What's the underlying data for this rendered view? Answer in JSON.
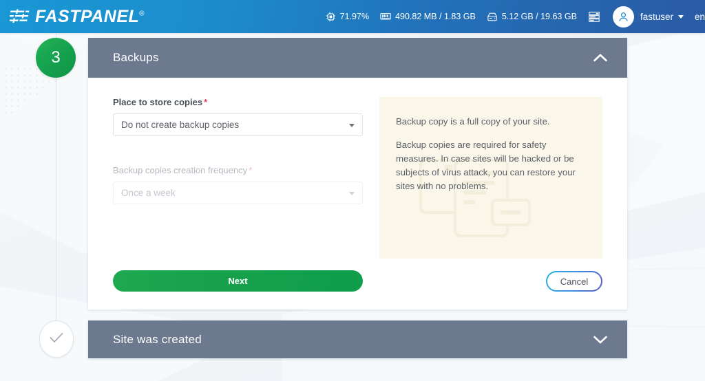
{
  "topbar": {
    "logo_text": "FASTPANEL",
    "logo_reg": "®",
    "logo_icon": "equalizer-icon",
    "stats": [
      {
        "icon": "cpu-icon",
        "value": "71.97%"
      },
      {
        "icon": "memory-icon",
        "value": "490.82 MB / 1.83 GB"
      },
      {
        "icon": "disk-icon",
        "value": "5.12 GB / 19.63 GB"
      }
    ],
    "server_icon": "server-stack-icon",
    "user": {
      "avatar_icon": "user-avatar-icon",
      "name": "fastuser",
      "caret_icon": "chevron-down-icon"
    },
    "language": "en"
  },
  "stepper": {
    "current_step_number": "3",
    "completed_icon": "check-icon"
  },
  "backups_card": {
    "title": "Backups",
    "collapse_icon": "chevron-up-icon",
    "place_field": {
      "label": "Place to store copies",
      "required_marker": "*",
      "value": "Do not create backup copies",
      "caret_icon": "chevron-down-icon"
    },
    "frequency_field": {
      "label": "Backup copies creation frequency",
      "required_marker": "*",
      "value": "Once a week",
      "caret_icon": "chevron-down-icon",
      "disabled": true
    },
    "info": {
      "paragraph1": "Backup copy is a full copy of your site.",
      "paragraph2": "Backup copies are required for safety measures. In case sites will be hacked or be subjects of virus attack, you can restore your sites with no problems.",
      "watermark_icon": "documents-copy-illustration"
    },
    "next_button": "Next",
    "cancel_button": "Cancel"
  },
  "created_card": {
    "title": "Site was created",
    "expand_icon": "chevron-down-icon"
  },
  "colors": {
    "topbar_gradient_start": "#1a97d5",
    "topbar_gradient_end": "#2a5ba4",
    "step_green": "#14a04d",
    "card_header": "#6d798f",
    "info_bg": "#faf7ea",
    "required_red": "#e8455f",
    "next_green": "#17a04c"
  }
}
